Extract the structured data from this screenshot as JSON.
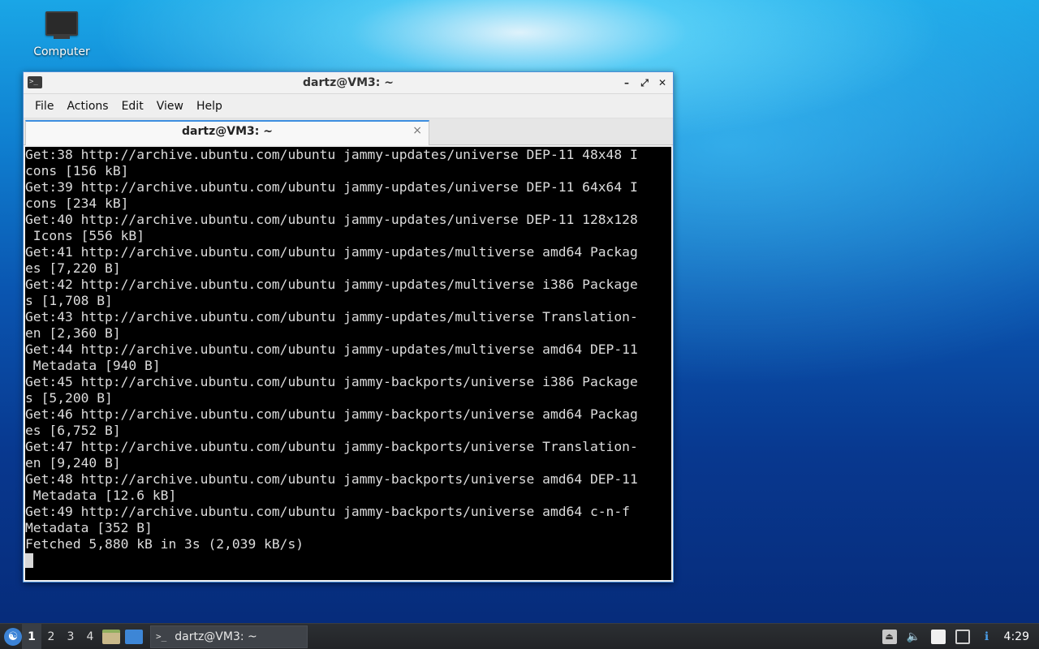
{
  "desktop": {
    "icons": [
      {
        "label": "Computer",
        "icon": "monitor-icon"
      }
    ]
  },
  "window": {
    "title": "dartz@VM3: ~",
    "menu": [
      "File",
      "Actions",
      "Edit",
      "View",
      "Help"
    ],
    "tab": {
      "title": "dartz@VM3: ~",
      "close": "×"
    },
    "controls": {
      "minimize": "–",
      "maximize": "⤢",
      "close": "✕"
    }
  },
  "terminal": {
    "lines": [
      "Get:38 http://archive.ubuntu.com/ubuntu jammy-updates/universe DEP-11 48x48 I",
      "cons [156 kB]",
      "Get:39 http://archive.ubuntu.com/ubuntu jammy-updates/universe DEP-11 64x64 I",
      "cons [234 kB]",
      "Get:40 http://archive.ubuntu.com/ubuntu jammy-updates/universe DEP-11 128x128",
      " Icons [556 kB]",
      "Get:41 http://archive.ubuntu.com/ubuntu jammy-updates/multiverse amd64 Packag",
      "es [7,220 B]",
      "Get:42 http://archive.ubuntu.com/ubuntu jammy-updates/multiverse i386 Package",
      "s [1,708 B]",
      "Get:43 http://archive.ubuntu.com/ubuntu jammy-updates/multiverse Translation-",
      "en [2,360 B]",
      "Get:44 http://archive.ubuntu.com/ubuntu jammy-updates/multiverse amd64 DEP-11",
      " Metadata [940 B]",
      "Get:45 http://archive.ubuntu.com/ubuntu jammy-backports/universe i386 Package",
      "s [5,200 B]",
      "Get:46 http://archive.ubuntu.com/ubuntu jammy-backports/universe amd64 Packag",
      "es [6,752 B]",
      "Get:47 http://archive.ubuntu.com/ubuntu jammy-backports/universe Translation-",
      "en [9,240 B]",
      "Get:48 http://archive.ubuntu.com/ubuntu jammy-backports/universe amd64 DEP-11",
      " Metadata [12.6 kB]",
      "Get:49 http://archive.ubuntu.com/ubuntu jammy-backports/universe amd64 c-n-f",
      "Metadata [352 B]",
      "Fetched 5,880 kB in 3s (2,039 kB/s)"
    ]
  },
  "taskbar": {
    "workspaces": [
      "1",
      "2",
      "3",
      "4"
    ],
    "active_workspace": "1",
    "task_label": "dartz@VM3: ~",
    "clock": "4:29"
  }
}
